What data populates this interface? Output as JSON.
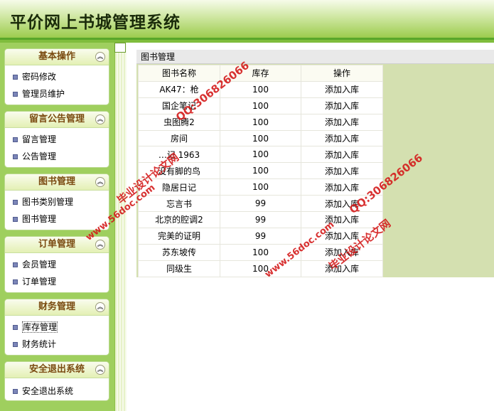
{
  "header": {
    "title": "平价网上书城管理系统"
  },
  "sidebar": {
    "groups": [
      {
        "title": "基本操作",
        "items": [
          "密码修改",
          "管理员维护"
        ]
      },
      {
        "title": "留言公告管理",
        "items": [
          "留言管理",
          "公告管理"
        ]
      },
      {
        "title": "图书管理",
        "items": [
          "图书类别管理",
          "图书管理"
        ]
      },
      {
        "title": "订单管理",
        "items": [
          "会员管理",
          "订单管理"
        ]
      },
      {
        "title": "财务管理",
        "items": [
          "库存管理",
          "财务统计"
        ]
      },
      {
        "title": "安全退出系统",
        "items": [
          "安全退出系统"
        ]
      }
    ]
  },
  "main": {
    "panel_title": "图书管理",
    "columns": [
      "图书名称",
      "库存",
      "操作"
    ],
    "rows": [
      [
        "AK47：枪",
        "100",
        "添加入库"
      ],
      [
        "国企笔记",
        "100",
        "添加入库"
      ],
      [
        "虫图腾2",
        "100",
        "添加入库"
      ],
      [
        "房间",
        "100",
        "添加入库"
      ],
      [
        "…记 1963",
        "100",
        "添加入库"
      ],
      [
        "没有脚的鸟",
        "100",
        "添加入库"
      ],
      [
        "隐居日记",
        "100",
        "添加入库"
      ],
      [
        "忘言书",
        "99",
        "添加入库"
      ],
      [
        "北京的腔调2",
        "99",
        "添加入库"
      ],
      [
        "完美的证明",
        "99",
        "添加入库"
      ],
      [
        "苏东坡传",
        "100",
        "添加入库"
      ],
      [
        "同级生",
        "100",
        "添加入库"
      ]
    ]
  },
  "watermarks": {
    "qq": "QQ:306826066",
    "site_name": "毕业设计论文网",
    "url": "www.56doc.com"
  },
  "colors": {
    "header_green": "#9ccc4e",
    "sidebar_green": "#9fcf5e",
    "watermark_red": "#d41b1b"
  }
}
